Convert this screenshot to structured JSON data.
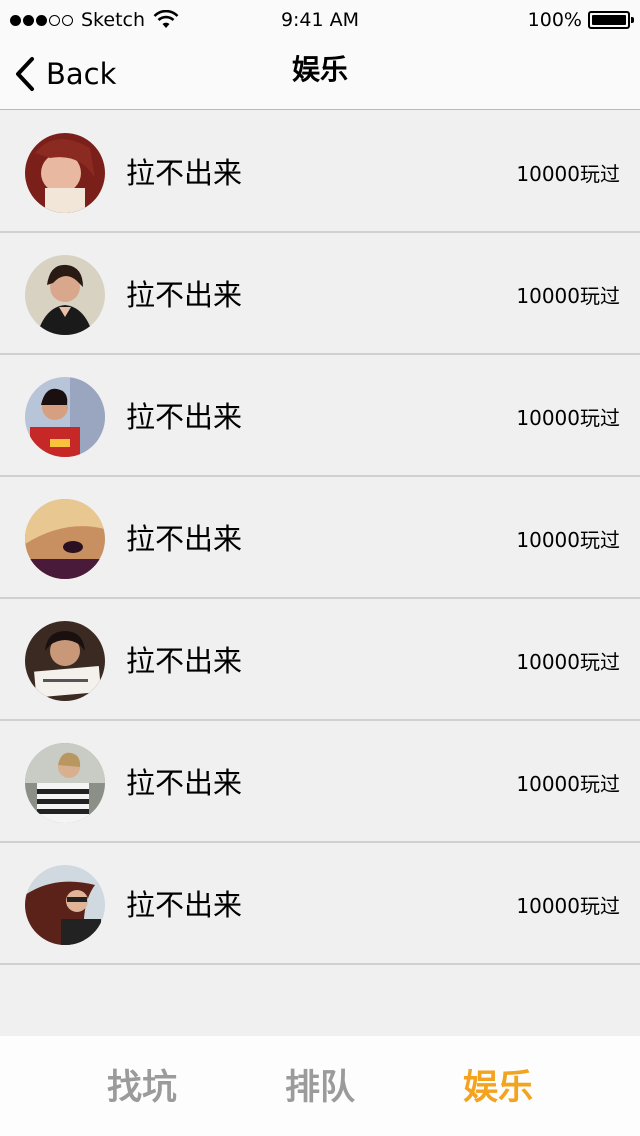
{
  "status_bar": {
    "carrier": "Sketch",
    "time": "9:41 AM",
    "battery": "100%"
  },
  "nav": {
    "back_label": "Back",
    "title": "娱乐"
  },
  "list": [
    {
      "title": "拉不出来",
      "count": "10000玩过",
      "avatar": "avatar-red-hair-woman"
    },
    {
      "title": "拉不出来",
      "count": "10000玩过",
      "avatar": "avatar-dark-hair-woman"
    },
    {
      "title": "拉不出来",
      "count": "10000玩过",
      "avatar": "avatar-woman-outdoors"
    },
    {
      "title": "拉不出来",
      "count": "10000玩过",
      "avatar": "avatar-blonde-closeup"
    },
    {
      "title": "拉不出来",
      "count": "10000玩过",
      "avatar": "avatar-woman-with-sign"
    },
    {
      "title": "拉不出来",
      "count": "10000玩过",
      "avatar": "avatar-woman-striped-shirt"
    },
    {
      "title": "拉不出来",
      "count": "10000玩过",
      "avatar": "avatar-windswept-hair"
    }
  ],
  "tabs": [
    {
      "label": "找坑",
      "active": false
    },
    {
      "label": "排队",
      "active": false
    },
    {
      "label": "娱乐",
      "active": true
    }
  ],
  "colors": {
    "accent": "#f3a31d",
    "tab_inactive": "#9b9b9b",
    "background": "#f0f0f0"
  }
}
